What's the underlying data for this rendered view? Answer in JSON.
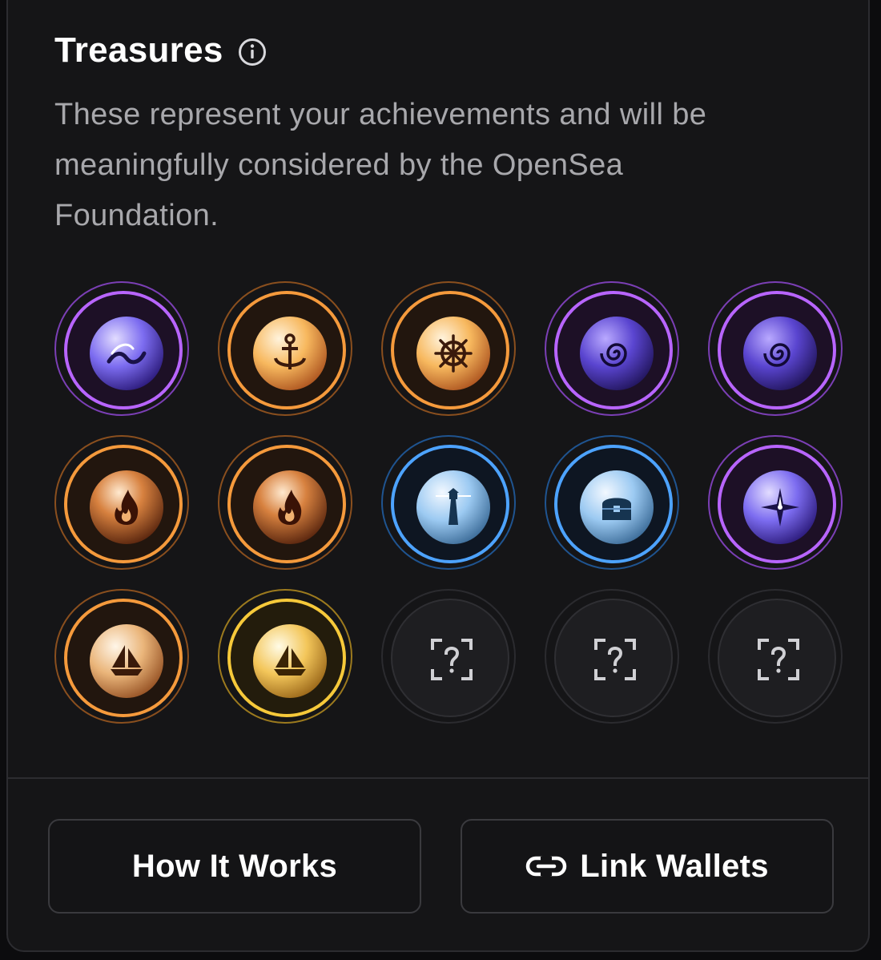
{
  "header": {
    "title": "Treasures",
    "info_icon": "info-icon",
    "description": "These represent your achievements and will be meaningfully considered by the OpenSea Foundation."
  },
  "treasures": [
    {
      "name": "wave-orb",
      "rarity": "epic",
      "ring_color": "#b865ff",
      "icon": "wave-icon",
      "state": "unlocked"
    },
    {
      "name": "anchor-orb",
      "rarity": "legendary",
      "ring_color": "#f59a3c",
      "icon": "anchor-icon",
      "state": "unlocked"
    },
    {
      "name": "ship-wheel-orb",
      "rarity": "legendary",
      "ring_color": "#f59a3c",
      "icon": "ship-wheel-icon",
      "state": "unlocked"
    },
    {
      "name": "swirl-orb",
      "rarity": "epic",
      "ring_color": "#b865ff",
      "icon": "swirl-icon",
      "state": "unlocked"
    },
    {
      "name": "swirl-orb-2",
      "rarity": "epic",
      "ring_color": "#b865ff",
      "icon": "swirl-icon",
      "state": "unlocked"
    },
    {
      "name": "flame-orb",
      "rarity": "legendary",
      "ring_color": "#f59a3c",
      "icon": "flame-icon",
      "state": "unlocked"
    },
    {
      "name": "flame-orb-2",
      "rarity": "legendary",
      "ring_color": "#f59a3c",
      "icon": "flame-icon",
      "state": "unlocked"
    },
    {
      "name": "lighthouse-orb",
      "rarity": "rare",
      "ring_color": "#4da3ff",
      "icon": "lighthouse-icon",
      "state": "unlocked"
    },
    {
      "name": "chest-orb",
      "rarity": "rare",
      "ring_color": "#4da3ff",
      "icon": "chest-icon",
      "state": "unlocked"
    },
    {
      "name": "compass-orb",
      "rarity": "epic",
      "ring_color": "#b865ff",
      "icon": "compass-icon",
      "state": "unlocked"
    },
    {
      "name": "ship-orb",
      "rarity": "legendary",
      "ring_color": "#f59a3c",
      "icon": "ship-icon",
      "state": "unlocked"
    },
    {
      "name": "golden-ship-orb",
      "rarity": "mythic",
      "ring_color": "#f6c93a",
      "icon": "ship-icon",
      "state": "unlocked"
    },
    {
      "name": "locked-1",
      "icon": "question-scan-icon",
      "state": "locked"
    },
    {
      "name": "locked-2",
      "icon": "question-scan-icon",
      "state": "locked"
    },
    {
      "name": "locked-3",
      "icon": "question-scan-icon",
      "state": "locked"
    }
  ],
  "footer": {
    "how_it_works_label": "How It Works",
    "link_wallets_label": "Link Wallets",
    "link_icon": "link-icon"
  }
}
